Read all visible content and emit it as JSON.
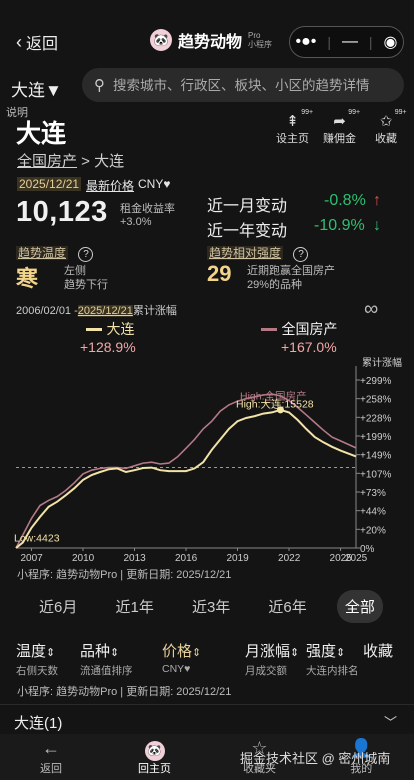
{
  "nav": {
    "back_label": "返回",
    "app_title": "趋势动物",
    "app_badge_top": "Pro",
    "app_badge_bottom": "小程序",
    "menu_icon": "more-dots-icon",
    "min_icon": "minimize-icon",
    "close_icon": "target-icon"
  },
  "search": {
    "city": "大连▼",
    "placeholder": "搜索城市、行政区、板块、小区的趋势详情"
  },
  "header": {
    "help": "说明",
    "city_name": "大连",
    "breadcrumb_root": "全国房产",
    "breadcrumb_sep": " > ",
    "breadcrumb_current": "大连",
    "actions": [
      {
        "label": "设主页",
        "badge": "99+",
        "icon": "pin-icon"
      },
      {
        "label": "赚佣金",
        "badge": "99+",
        "icon": "share-icon"
      },
      {
        "label": "收藏",
        "badge": "99+",
        "icon": "star-icon"
      }
    ]
  },
  "price": {
    "date": "2025/12/21",
    "label": "最新价格",
    "currency": "CNY♥",
    "value": "10,123",
    "yield_label": "租金收益率",
    "yield_value": "+3.0%"
  },
  "changes": [
    {
      "label": "近一月变动",
      "value": "-0.8%",
      "arrow": "↑"
    },
    {
      "label": "近一年变动",
      "value": "-10.9%",
      "arrow": "↓"
    }
  ],
  "trend": {
    "tag": "趋势温度",
    "value": "寒",
    "desc1": "左侧",
    "desc2": "趋势下行"
  },
  "strength": {
    "tag": "趋势相对强度",
    "value": "29",
    "desc1": "近期跑赢全国房产",
    "desc2": "29%的品种"
  },
  "chart_header": {
    "start": "2006/02/01",
    "sep": " -",
    "end": "2025/12/21",
    "suffix": "累计涨幅",
    "loop_icon": "infinity-icon"
  },
  "chart_data": {
    "type": "line",
    "series": [
      {
        "name": "大连",
        "change": "+128.9%",
        "color": "#f2e3a8",
        "x": [
          2006.1,
          2006.5,
          2007,
          2007.5,
          2008,
          2008.5,
          2009,
          2009.5,
          2010,
          2010.5,
          2011,
          2011.5,
          2012,
          2012.5,
          2013,
          2013.5,
          2014,
          2014.5,
          2015,
          2015.5,
          2016,
          2016.5,
          2017,
          2017.5,
          2018,
          2018.5,
          2019,
          2019.5,
          2020,
          2020.5,
          2021,
          2021.5,
          2022,
          2022.5,
          2023,
          2023.5,
          2024,
          2024.5,
          2025,
          2025.9
        ],
        "y": [
          0,
          6,
          22,
          36,
          50,
          58,
          68,
          80,
          95,
          104,
          110,
          116,
          118,
          110,
          114,
          119,
          120,
          114,
          112,
          112,
          112,
          118,
          132,
          162,
          190,
          210,
          222,
          227,
          230,
          234,
          236,
          240,
          236,
          224,
          210,
          196,
          182,
          170,
          160,
          145
        ]
      },
      {
        "name": "全国房产",
        "change": "+167.0%",
        "color": "#b37a86",
        "x": [
          2006.1,
          2006.5,
          2007,
          2007.5,
          2008,
          2008.5,
          2009,
          2009.5,
          2010,
          2010.5,
          2011,
          2011.5,
          2012,
          2012.5,
          2013,
          2013.5,
          2014,
          2014.5,
          2015,
          2015.5,
          2016,
          2016.5,
          2017,
          2017.5,
          2018,
          2018.5,
          2019,
          2019.5,
          2020,
          2020.5,
          2021,
          2021.5,
          2022,
          2022.5,
          2023,
          2023.5,
          2024,
          2024.5,
          2025,
          2025.9
        ],
        "y": [
          0,
          14,
          34,
          52,
          60,
          66,
          76,
          90,
          106,
          114,
          118,
          120,
          120,
          118,
          124,
          130,
          132,
          128,
          130,
          144,
          166,
          190,
          210,
          222,
          238,
          248,
          254,
          258,
          262,
          266,
          268,
          264,
          255,
          244,
          232,
          220,
          208,
          196,
          186,
          167
        ]
      }
    ],
    "x_ticks": [
      "2007",
      "2010",
      "2013",
      "2016",
      "2019",
      "2022",
      "2025"
    ],
    "x_tick_values": [
      2007,
      2010,
      2013,
      2016,
      2019,
      2022,
      2025
    ],
    "x_end_label": "2025",
    "y_ticks": [
      "+299%",
      "+258%",
      "+228%",
      "+199%",
      "+149%",
      "+107%",
      "+73%",
      "+44%",
      "+20%",
      "0%"
    ],
    "y_tick_values": [
      299,
      258,
      228,
      199,
      149,
      107,
      73,
      44,
      20,
      0
    ],
    "y_axis_title": "累计涨幅",
    "ylim": [
      0,
      310
    ],
    "xlim": [
      2006.1,
      2025.9
    ],
    "reference_line": 120,
    "annotations": {
      "high_national": "High:全国房产",
      "high_dalian": "High:大连:15528",
      "low_dalian": "Low:4423"
    },
    "high_dalian_point": [
      2021.5,
      240
    ]
  },
  "chart_footer": "小程序: 趋势动物Pro | 更新日期: 2025/12/21",
  "tabs": [
    {
      "label": "近6月",
      "active": false
    },
    {
      "label": "近1年",
      "active": false
    },
    {
      "label": "近3年",
      "active": false
    },
    {
      "label": "近6年",
      "active": false
    },
    {
      "label": "全部",
      "active": true
    }
  ],
  "columns": [
    {
      "title": "温度",
      "sort": "⇕",
      "sub": "右侧天数"
    },
    {
      "title": "品种",
      "sort": "⇕",
      "sub": "流通值排序"
    },
    {
      "title": "价格",
      "sort": "⇕",
      "sub": "CNY♥",
      "highlight": true
    },
    {
      "title": "月涨幅",
      "sort": "⇕",
      "sub": "月成交额"
    },
    {
      "title": "强度",
      "sort": "⇕",
      "sub": "大连内排名"
    },
    {
      "title": "收藏",
      "sort": "",
      "sub": ""
    }
  ],
  "list_footer": "小程序: 趋势动物Pro | 更新日期: 2025/12/21",
  "list": {
    "group_label": "大连(1)",
    "chevron": "chevron-down-icon"
  },
  "tabbar": [
    {
      "label": "返回",
      "icon": "arrow-left-icon"
    },
    {
      "label": "回主页",
      "icon": "home-logo-icon"
    },
    {
      "label": "收藏夹",
      "icon": "star-outline-icon"
    },
    {
      "label": "我的",
      "icon": "user-icon"
    }
  ],
  "watermark": "掘金技术社区 @ 密州城南"
}
